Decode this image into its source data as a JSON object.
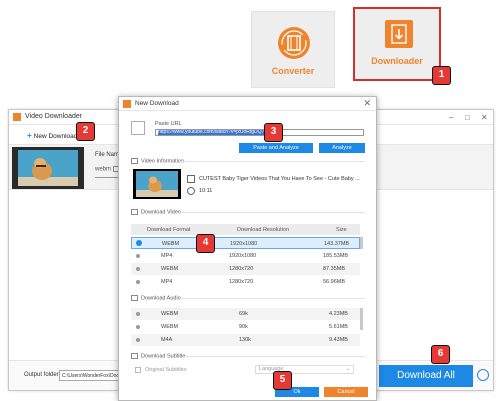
{
  "launcher": {
    "converter_label": "Converter",
    "downloader_label": "Downloader"
  },
  "badges": [
    "1",
    "2",
    "3",
    "4",
    "5",
    "6"
  ],
  "bg_window": {
    "title": "Video Downloader",
    "new_download": "New Download",
    "file_name_label": "File Name",
    "format_label": "webm",
    "output_folder_label": "Output folder:",
    "output_folder_value": "C:\\Users\\WonderFox\\Docum",
    "download_all": "Download All"
  },
  "dialog": {
    "title": "New Download",
    "paste_url_label": "Paste URL",
    "url_value": "https://www.youtube.com/watch?v=jxUoRtgDQ7w",
    "paste_analyze": "Paste and Analyze",
    "analyze": "Analyze",
    "video_info_label": "Video Information",
    "video_title": "CUTEST Baby Tiger Videos That You Have To See - Cute Baby ...",
    "duration": "10:11",
    "download_video_label": "Download Video",
    "video_headers": [
      "Download Format",
      "Download Resolution",
      "Size"
    ],
    "video_rows": [
      {
        "format": "WEBM",
        "resolution": "1920x1080",
        "size": "143.37MB",
        "selected": true
      },
      {
        "format": "MP4",
        "resolution": "1920x1080",
        "size": "185.53MB",
        "selected": false
      },
      {
        "format": "WEBM",
        "resolution": "1280x720",
        "size": "87.35MB",
        "selected": false
      },
      {
        "format": "MP4",
        "resolution": "1280x720",
        "size": "56.96MB",
        "selected": false
      }
    ],
    "download_audio_label": "Download Audio",
    "audio_rows": [
      {
        "format": "WEBM",
        "bitrate": "69k",
        "size": "4.23MB"
      },
      {
        "format": "WEBM",
        "bitrate": "90k",
        "size": "5.61MB"
      },
      {
        "format": "M4A",
        "bitrate": "130k",
        "size": "9.43MB"
      }
    ],
    "download_subtitle_label": "Download Subtitle",
    "original_subtitles": "Original Subtitles",
    "language_placeholder": "Language",
    "ok": "Ok",
    "cancel": "Cancel"
  },
  "colors": {
    "accent_orange": "#f0842c",
    "accent_blue": "#1e88e5",
    "badge_red": "#e53935",
    "highlight_border": "#d32f2f"
  }
}
